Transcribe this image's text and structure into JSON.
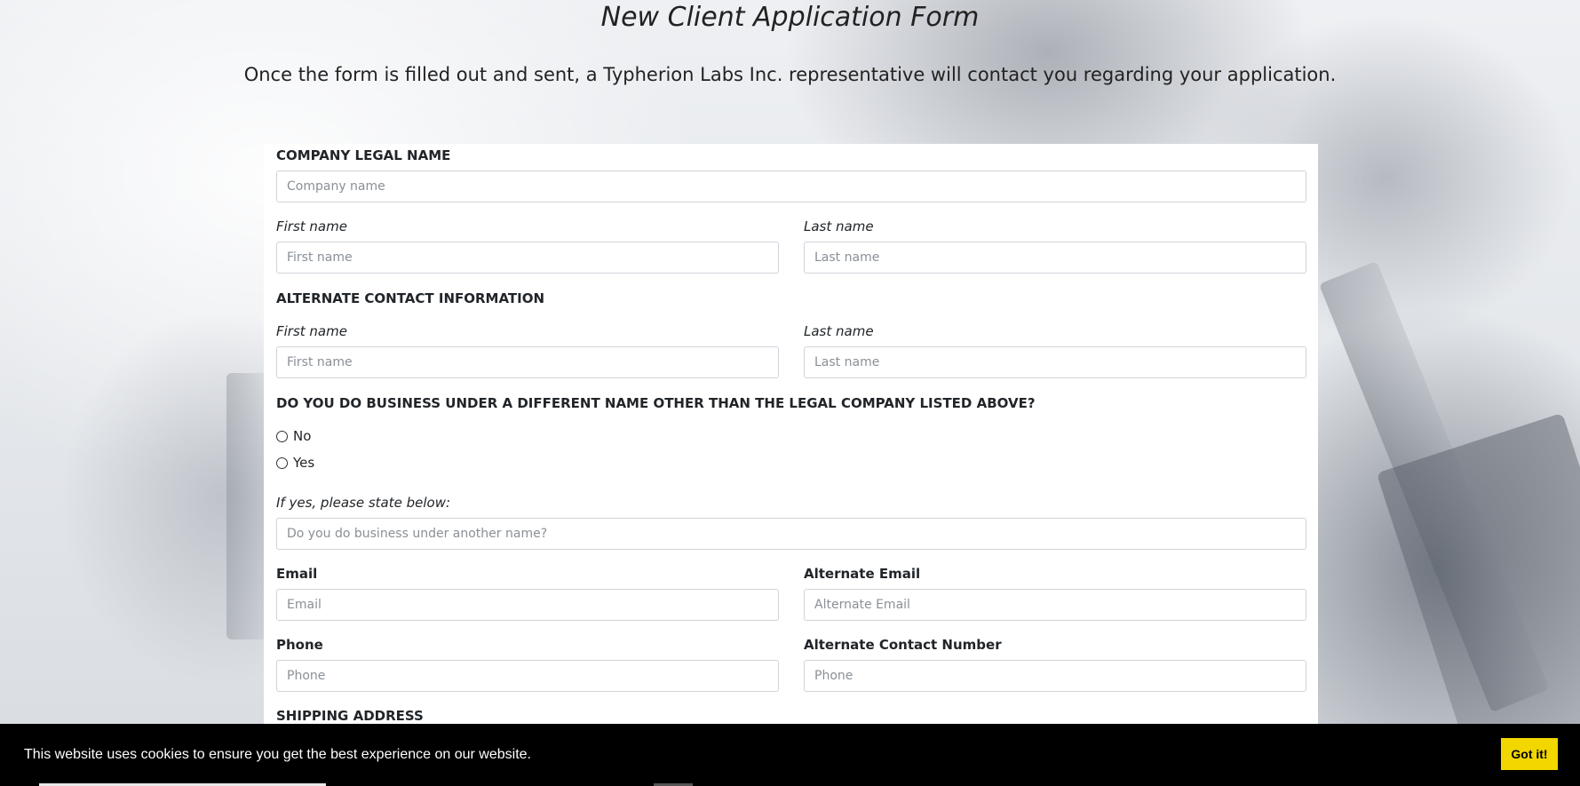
{
  "header": {
    "title": "New Client Application Form",
    "subtitle": "Once the form is filled out and sent, a Typherion Labs Inc. representative will contact you regarding your application."
  },
  "form": {
    "company": {
      "section_label": "COMPANY LEGAL NAME",
      "placeholder": "Company name"
    },
    "primary": {
      "first_label": "First name",
      "first_placeholder": "First name",
      "last_label": "Last name",
      "last_placeholder": "Last name"
    },
    "alternate": {
      "section_label": "ALTERNATE CONTACT INFORMATION",
      "first_label": "First name",
      "first_placeholder": "First name",
      "last_label": "Last name",
      "last_placeholder": "Last name"
    },
    "dba": {
      "question": "DO YOU DO BUSINESS UNDER A DIFFERENT NAME OTHER THAN THE LEGAL COMPANY LISTED ABOVE?",
      "options": [
        "No",
        "Yes"
      ],
      "selected": "",
      "if_yes_label": "If yes, please state below:",
      "placeholder": "Do you do business under another name?"
    },
    "email": {
      "label": "Email",
      "placeholder": "Email",
      "alt_label": "Alternate Email",
      "alt_placeholder": "Alternate Email"
    },
    "phone": {
      "label": "Phone",
      "placeholder": "Phone",
      "alt_label": "Alternate Contact Number",
      "alt_placeholder": "Phone"
    },
    "shipping": {
      "section_label": "SHIPPING ADDRESS"
    }
  },
  "cookie_banner": {
    "message": "This website uses cookies to ensure you get the best experience on our website.",
    "button_label": "Got it!",
    "button_color": "#f1d600",
    "background_color": "#000000"
  }
}
